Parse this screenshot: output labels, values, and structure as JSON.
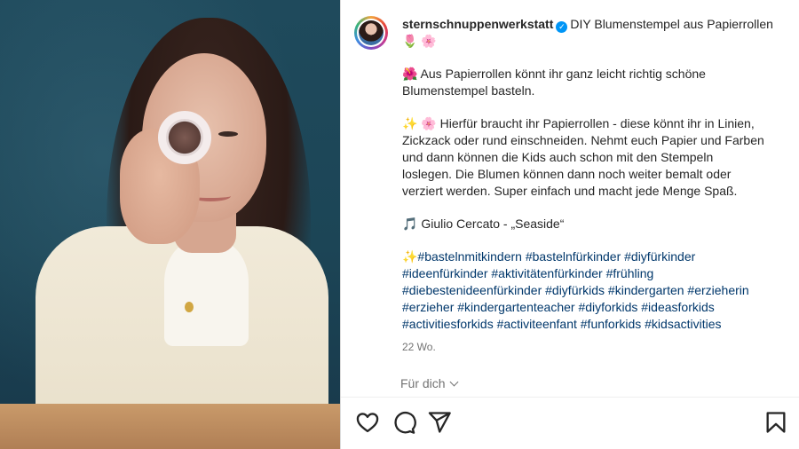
{
  "post": {
    "username": "sternschnuppenwerkstatt",
    "title_line": "DIY Blumenstempel aus Papierrollen",
    "title_emoji": "🌷 🌸",
    "para1_line1": "🌺 Aus Papierrollen könnt ihr ganz leicht richtig schöne",
    "para1_line2": "Blumenstempel basteln.",
    "para2_lines": [
      "✨ 🌸 Hierfür braucht ihr Papierrollen - diese könnt ihr in Linien,",
      "Zickzack oder rund einschneiden. Nehmt euch Papier und Farben",
      "und dann können die Kids auch schon mit den Stempeln",
      "loslegen. Die Blumen können dann noch weiter bemalt oder",
      "verziert werden. Super einfach und macht jede Menge Spaß."
    ],
    "music": "🎵 Giulio Cercato - „Seaside“",
    "hashtags": [
      "✨#bastelnmitkindern #bastelnfürkinder #diyfürkinder",
      "#ideenfürkinder #aktivitätenfürkinder #frühling",
      "#diebestenideenfürkinder #diyfürkids #kindergarten #erzieherin",
      "#erzieher #kindergartenteacher #diyforkids #ideasforkids",
      "#activitiesforkids #activiteenfant #funforkids #kidsactivities"
    ],
    "timestamp": "22 Wo."
  },
  "translate_label": "Für dich",
  "icons": {
    "verified": "verified-badge-icon",
    "like": "heart-icon",
    "comment": "comment-icon",
    "share": "send-icon",
    "save": "bookmark-icon",
    "chevron": "chevron-down-icon"
  },
  "colors": {
    "hashtag": "#00376b",
    "verified": "#0095f6",
    "muted": "#737373"
  }
}
